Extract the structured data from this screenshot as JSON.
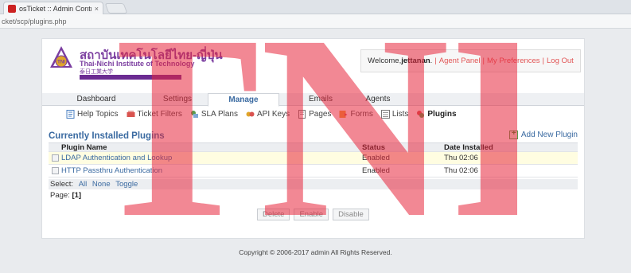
{
  "browser": {
    "tab_title": "osTicket :: Admin Contro",
    "tab_close": "×",
    "url": "cket/scp/plugins.php"
  },
  "header": {
    "logo_th": "สถาบันเทคโนโลยีไทย-ญี่ปุ่น",
    "logo_en": "Thai-Nichi Institute of Technology",
    "logo_jp": "泰日工業大学",
    "logo_emblem_text": "TNI",
    "welcome": {
      "prefix": "Welcome, ",
      "user": "jettanan",
      "after_user": ".",
      "agent_panel": "Agent Panel",
      "my_preferences": "My Preferences",
      "logout": "Log Out",
      "separator": "|"
    }
  },
  "nav": {
    "items": [
      {
        "label": "Dashboard"
      },
      {
        "label": "Settings"
      },
      {
        "label": "Manage"
      },
      {
        "label": "Emails"
      },
      {
        "label": "Agents"
      }
    ]
  },
  "subnav": {
    "items": [
      {
        "label": "Help Topics",
        "icon": "help-topics-icon"
      },
      {
        "label": "Ticket Filters",
        "icon": "ticket-filters-icon"
      },
      {
        "label": "SLA Plans",
        "icon": "sla-plans-icon"
      },
      {
        "label": "API Keys",
        "icon": "api-keys-icon"
      },
      {
        "label": "Pages",
        "icon": "pages-icon"
      },
      {
        "label": "Forms",
        "icon": "forms-icon"
      },
      {
        "label": "Lists",
        "icon": "lists-icon"
      },
      {
        "label": "Plugins",
        "icon": "plugins-icon"
      }
    ]
  },
  "main": {
    "title": "Currently Installed Plugins",
    "add_plugin": "Add New Plugin",
    "table": {
      "columns": [
        "Plugin Name",
        "Status",
        "Date Installed"
      ],
      "rows": [
        {
          "name": "LDAP Authentication and Lookup",
          "status": "Enabled",
          "date": "Thu 02:06"
        },
        {
          "name": "HTTP Passthru Authentication",
          "status": "Enabled",
          "date": "Thu 02:06"
        }
      ]
    },
    "select": {
      "label": "Select:",
      "all": "All",
      "none": "None",
      "toggle": "Toggle"
    },
    "page_label": "Page:",
    "page_value": "[1]",
    "buttons": {
      "delete": "Delete",
      "enable": "Enable",
      "disable": "Disable"
    }
  },
  "footer": "Copyright © 2006-2017 admin All Rights Reserved.",
  "watermark_text": "TNI",
  "colors": {
    "accent": "#3a6aa1",
    "link_red": "#e25555",
    "highlight_row": "#fffde1",
    "brand_purple": "#7b3ea0",
    "watermark": "#e8263c"
  }
}
